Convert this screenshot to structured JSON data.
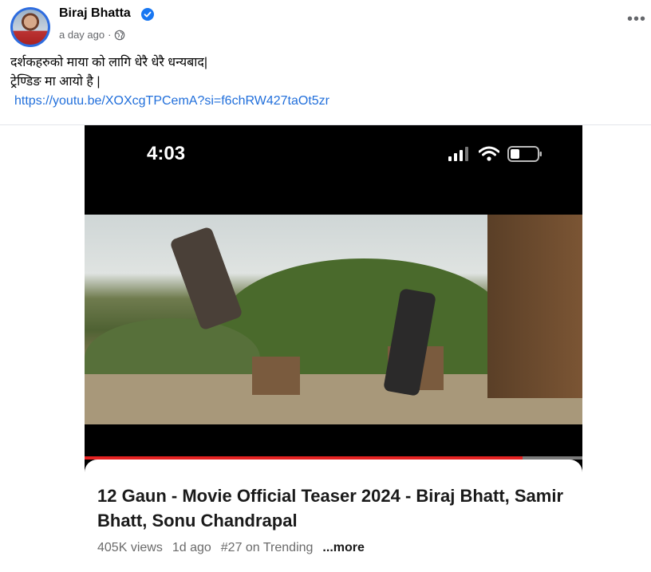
{
  "post": {
    "author": "Biraj Bhatta",
    "time": "a day ago",
    "separator": "·",
    "more_icon": "ellipsis-icon",
    "lines": [
      "दर्शकहरुको माया को लागि धेरै धेरै धन्यबाद|",
      "ट्रेण्डिङ मा आयो है |"
    ],
    "link": "https://youtu.be/XOXcgTPCemA?si=f6chRW427taOt5zr"
  },
  "media": {
    "phone_time": "4:03",
    "video_progress_percent": 88,
    "video_title": "12 Gaun - Movie Official Teaser 2024 - Biraj Bhatt, Samir Bhatt, Sonu Chandrapal",
    "views": "405K views",
    "age": "1d ago",
    "trending": "#27 on Trending",
    "more": "...more"
  },
  "colors": {
    "verified": "#1877f2",
    "link": "#216fdb",
    "progress": "#e52222"
  }
}
